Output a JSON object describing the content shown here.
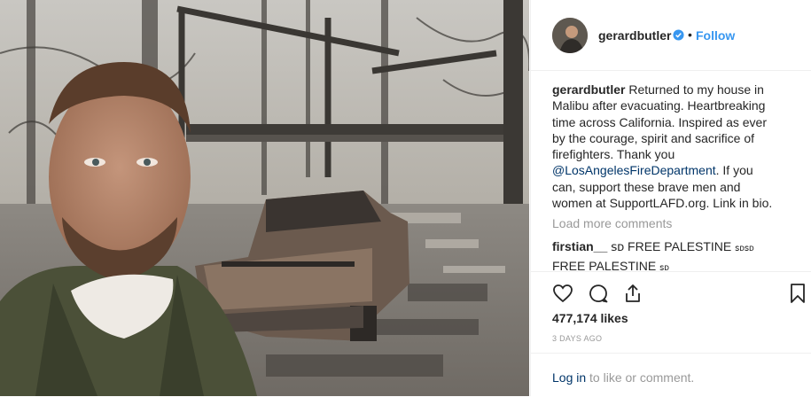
{
  "post": {
    "username": "gerardbutler",
    "follow_label": "Follow",
    "separator": "•",
    "caption_username": "gerardbutler",
    "caption_text_1": " Returned to my house in Malibu after evacuating. Heartbreaking time across California. Inspired as ever by the courage, spirit and sacrifice of firefighters. Thank you ",
    "caption_mention": "@LosAngelesFireDepartment",
    "caption_text_2": ". If you can, support these brave men and women at SupportLAFD.org. Link in bio.",
    "load_more": "Load more comments",
    "comment": {
      "username": "firstian__",
      "text_1": " ꜱᴅ FREE PALESTINE ",
      "text_small": "ꜱᴅꜱᴅ",
      "text_2": " FREE PALESTINE ",
      "text_end": "ꜱᴅ"
    },
    "likes": "477,174 likes",
    "date": "3 DAYS AGO",
    "footer_login": "Log in",
    "footer_rest": " to like or comment."
  },
  "icons": {
    "like": "heart-icon",
    "comment": "comment-icon",
    "share": "share-icon",
    "save": "bookmark-icon",
    "verified": "verified-badge-icon"
  },
  "colors": {
    "link": "#3897f0",
    "mention": "#003569",
    "text": "#262626",
    "muted": "#999999"
  }
}
